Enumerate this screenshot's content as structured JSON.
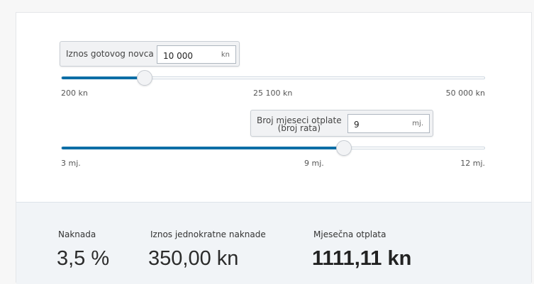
{
  "amount_slider": {
    "label": "Iznos gotovog novca",
    "value": "10 000",
    "unit": "kn",
    "min_label": "200 kn",
    "mid_label": "25 100 kn",
    "max_label": "50 000 kn",
    "min": 200,
    "max": 50000,
    "current": 10000
  },
  "months_slider": {
    "label_line1": "Broj mjeseci otplate",
    "label_line2": "(broj rata)",
    "value": "9",
    "unit": "mj.",
    "min_label": "3 mj.",
    "mid_label": "9 mj.",
    "max_label": "12 mj.",
    "min": 3,
    "max": 12,
    "current": 9
  },
  "summary": {
    "fee_label": "Naknada",
    "fee_value": "3,5 %",
    "onetime_label": "Iznos jednokratne naknade",
    "onetime_value": "350,00 kn",
    "monthly_label": "Mjesečna otplata",
    "monthly_value": "1111,11 kn"
  },
  "colors": {
    "accent": "#0b6ea6",
    "panel": "#f1f4f7"
  }
}
